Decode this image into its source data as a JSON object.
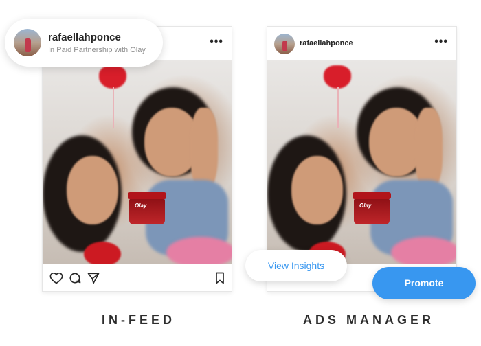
{
  "left_card": {
    "username": "rafaellahponce",
    "subtitle": "In Paid Partnership with Olay",
    "more_label": "•••",
    "jar_label": "Olay",
    "caption": "IN-FEED"
  },
  "right_card": {
    "username": "rafaellahponce",
    "more_label": "•••",
    "jar_label": "Olay",
    "caption": "ADS MANAGER"
  },
  "buttons": {
    "insights_label": "View Insights",
    "promote_label": "Promote"
  },
  "colors": {
    "accent": "#3897f0",
    "text": "#262626",
    "muted": "#8e8e8e"
  },
  "icons": [
    "heart-icon",
    "comment-icon",
    "share-icon",
    "bookmark-icon",
    "more-icon"
  ]
}
